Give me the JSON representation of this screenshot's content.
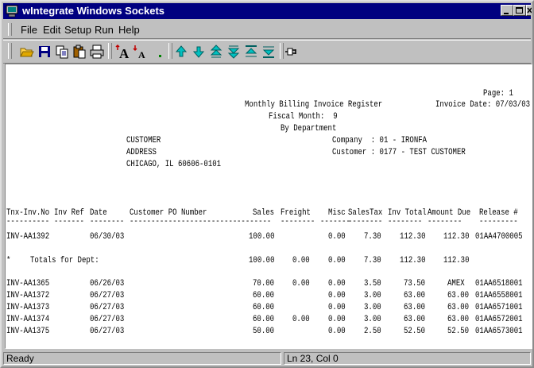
{
  "window": {
    "title": "wIntegrate Windows Sockets"
  },
  "menu": {
    "file": "File",
    "edit": "Edit",
    "setup": "Setup",
    "run": "Run",
    "help": "Help"
  },
  "toolbar": {
    "icons": [
      "open-folder-icon",
      "save-disk-icon",
      "copy-icon",
      "paste-icon",
      "print-icon",
      "font-larger-icon",
      "font-smaller-icon",
      "dot-icon",
      "arrow-up-icon",
      "arrow-down-icon",
      "page-up-icon",
      "page-down-icon",
      "top-icon",
      "bottom-icon",
      "connect-plug-icon"
    ],
    "font_big_label": "A",
    "font_small_label": "A"
  },
  "report": {
    "page": "Page: 1",
    "title": "Monthly Billing Invoice Register",
    "invoice_date": "Invoice Date: 07/03/03",
    "fiscal_month": "Fiscal Month:  9",
    "by_department": "By Department",
    "customer_label": "CUSTOMER",
    "company": "Company  : 01 - IRONFA",
    "address_label": "ADDRESS",
    "customer": "Customer : 0177 - TEST CUSTOMER",
    "city": "CHICAGO, IL 60606-0101",
    "columns": {
      "tnx": "Tnx-Inv.No",
      "invref": "Inv Ref",
      "date": "Date",
      "po": "Customer PO Number",
      "sales": "Sales",
      "freight": "Freight",
      "misc": "Misc",
      "salestax": "SalesTax",
      "invtotal": "Inv Total",
      "amountdue": "Amount Due",
      "release": "Release #"
    },
    "underlines": {
      "tnx": "----------",
      "invref": "-------",
      "date": "--------",
      "po": "-------------------------",
      "sales": "--------",
      "freight": "--------",
      "misc": "-------",
      "salestax": "--------",
      "invtotal": "--------",
      "amountdue": "--------",
      "release": "---------"
    },
    "row1": {
      "tnx": "INV-AA1392",
      "date": "06/30/03",
      "sales": "100.00",
      "misc": "0.00",
      "tax": "7.30",
      "total": "112.30",
      "due": "112.30",
      "release": "01AA4700005"
    },
    "dept_total": {
      "marker": "*",
      "label": "Totals for Dept:",
      "sales": "100.00",
      "freight": "0.00",
      "misc": "0.00",
      "tax": "7.30",
      "total": "112.30",
      "due": "112.30"
    },
    "rows": [
      {
        "tnx": "INV-AA1365",
        "date": "06/26/03",
        "sales": "70.00",
        "freight": "0.00",
        "misc": "0.00",
        "tax": "3.50",
        "total": "73.50",
        "due": "AMEX",
        "release": "01AA6518001"
      },
      {
        "tnx": "INV-AA1372",
        "date": "06/27/03",
        "sales": "60.00",
        "freight": "",
        "misc": "0.00",
        "tax": "3.00",
        "total": "63.00",
        "due": "63.00",
        "release": "01AA6558001"
      },
      {
        "tnx": "INV-AA1373",
        "date": "06/27/03",
        "sales": "60.00",
        "freight": "",
        "misc": "0.00",
        "tax": "3.00",
        "total": "63.00",
        "due": "63.00",
        "release": "01AA6571001"
      },
      {
        "tnx": "INV-AA1374",
        "date": "06/27/03",
        "sales": "60.00",
        "freight": "0.00",
        "misc": "0.00",
        "tax": "3.00",
        "total": "63.00",
        "due": "63.00",
        "release": "01AA6572001"
      },
      {
        "tnx": "INV-AA1375",
        "date": "06/27/03",
        "sales": "50.00",
        "freight": "",
        "misc": "0.00",
        "tax": "2.50",
        "total": "52.50",
        "due": "52.50",
        "release": "01AA6573001"
      }
    ]
  },
  "status": {
    "ready": "Ready",
    "position": "Ln 23, Col 0"
  }
}
